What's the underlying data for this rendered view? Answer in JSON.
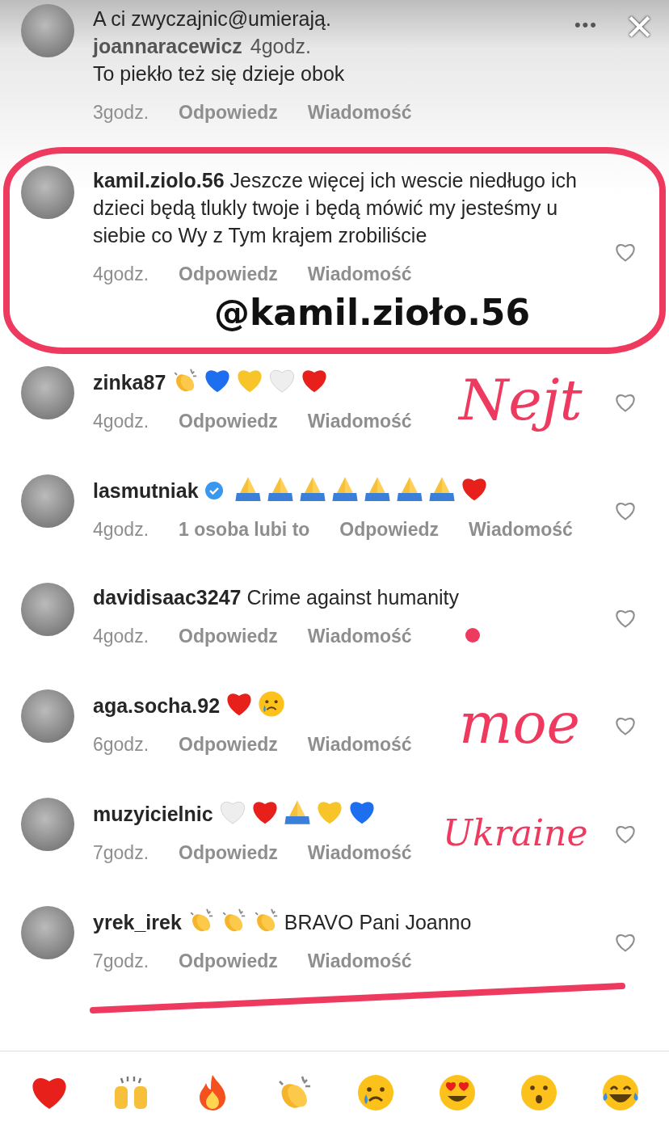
{
  "header": {
    "more": "•••",
    "close": "✕"
  },
  "top_comment": {
    "username": "joannaracewicz",
    "time_overlay": "4godz.",
    "lines": [
      "A ci zwyczajnic@umierają.",
      "To piekło też się dzieje obok"
    ],
    "meta": [
      {
        "kind": "time",
        "text": "3godz."
      },
      {
        "kind": "action",
        "text": "Odpowiedz"
      },
      {
        "kind": "action",
        "text": "Wiadomość"
      }
    ]
  },
  "comments": [
    {
      "username": "kamil.ziolo.56",
      "verified": false,
      "body": [
        {
          "kind": "text",
          "text": "Jeszcze więcej ich wescie niedługo ich dzieci będą tlukly twoje i będą mówić my jesteśmy u siebie co Wy z Tym krajem zrobiliście"
        }
      ],
      "meta": [
        {
          "kind": "time",
          "text": "4godz."
        },
        {
          "kind": "action",
          "text": "Odpowiedz"
        },
        {
          "kind": "action",
          "text": "Wiadomość"
        }
      ]
    },
    {
      "username": "zinka87",
      "verified": false,
      "body": [
        {
          "kind": "clap"
        },
        {
          "kind": "heart",
          "color": "#1e6ff0"
        },
        {
          "kind": "heart",
          "color": "#f7c52a"
        },
        {
          "kind": "heart",
          "color": "#eeeeee"
        },
        {
          "kind": "heart",
          "color": "#e8201c"
        }
      ],
      "meta": [
        {
          "kind": "time",
          "text": "4godz."
        },
        {
          "kind": "action",
          "text": "Odpowiedz"
        },
        {
          "kind": "action",
          "text": "Wiadomość"
        }
      ]
    },
    {
      "username": "lasmutniak",
      "verified": true,
      "body": [
        {
          "kind": "pray"
        },
        {
          "kind": "pray"
        },
        {
          "kind": "pray"
        },
        {
          "kind": "pray"
        },
        {
          "kind": "pray"
        },
        {
          "kind": "pray"
        },
        {
          "kind": "pray"
        },
        {
          "kind": "heart",
          "color": "#e8201c"
        }
      ],
      "meta": [
        {
          "kind": "time",
          "text": "4godz."
        },
        {
          "kind": "likes",
          "text": "1 osoba lubi to"
        },
        {
          "kind": "action",
          "text": "Odpowiedz"
        },
        {
          "kind": "action",
          "text": "Wiadomość"
        }
      ]
    },
    {
      "username": "davidisaac3247",
      "verified": false,
      "body": [
        {
          "kind": "text",
          "text": "Crime against humanity"
        }
      ],
      "meta": [
        {
          "kind": "time",
          "text": "4godz."
        },
        {
          "kind": "action",
          "text": "Odpowiedz"
        },
        {
          "kind": "action",
          "text": "Wiadomość"
        }
      ]
    },
    {
      "username": "aga.socha.92",
      "verified": false,
      "body": [
        {
          "kind": "heart",
          "color": "#e8201c"
        },
        {
          "kind": "cry"
        }
      ],
      "meta": [
        {
          "kind": "time",
          "text": "6godz."
        },
        {
          "kind": "action",
          "text": "Odpowiedz"
        },
        {
          "kind": "action",
          "text": "Wiadomość"
        }
      ]
    },
    {
      "username": "muzyicielnic",
      "verified": false,
      "body": [
        {
          "kind": "heart",
          "color": "#eeeeee"
        },
        {
          "kind": "heart",
          "color": "#e8201c"
        },
        {
          "kind": "pray"
        },
        {
          "kind": "heart",
          "color": "#f7c52a"
        },
        {
          "kind": "heart",
          "color": "#1e6ff0"
        }
      ],
      "meta": [
        {
          "kind": "time",
          "text": "7godz."
        },
        {
          "kind": "action",
          "text": "Odpowiedz"
        },
        {
          "kind": "action",
          "text": "Wiadomość"
        }
      ]
    },
    {
      "username": "yrek_irek",
      "verified": false,
      "body": [
        {
          "kind": "clap"
        },
        {
          "kind": "clap"
        },
        {
          "kind": "clap"
        },
        {
          "kind": "text",
          "text": "BRAVO Pani Joanno"
        }
      ],
      "meta": [
        {
          "kind": "time",
          "text": "7godz."
        },
        {
          "kind": "action",
          "text": "Odpowiedz"
        },
        {
          "kind": "action",
          "text": "Wiadomość"
        }
      ]
    }
  ],
  "reactions": [
    {
      "kind": "heart"
    },
    {
      "kind": "raised"
    },
    {
      "kind": "fire"
    },
    {
      "kind": "clap"
    },
    {
      "kind": "cry"
    },
    {
      "kind": "hearteyes"
    },
    {
      "kind": "surprised"
    },
    {
      "kind": "laugh"
    }
  ],
  "annotations": {
    "mention": "@kamil.zioło.56",
    "handwriting": [
      "Nejt",
      "moe",
      "Ukraine"
    ]
  }
}
